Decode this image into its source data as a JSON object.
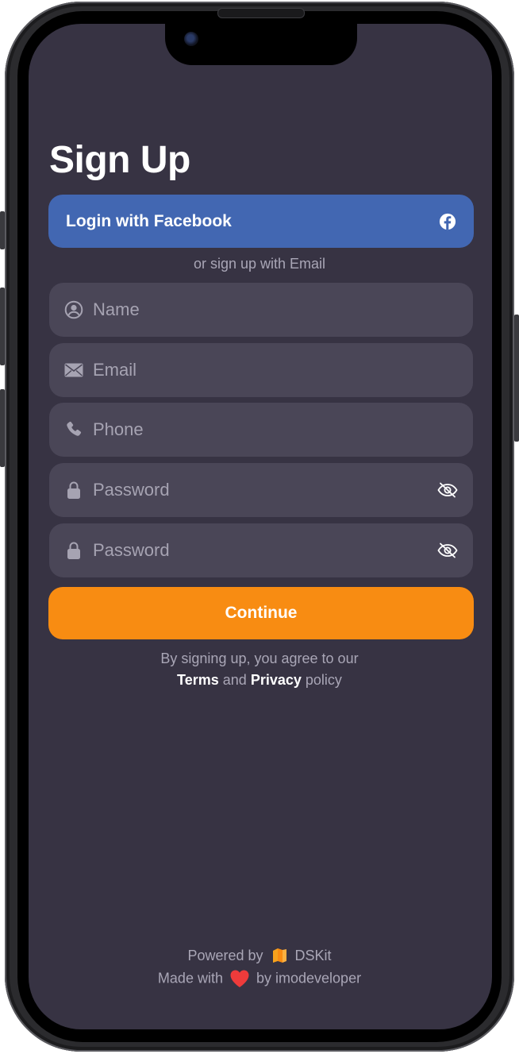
{
  "screen": {
    "title": "Sign Up"
  },
  "facebook_button": {
    "label": "Login with Facebook",
    "icon": "facebook-icon",
    "color": "#4267b2"
  },
  "divider_text": "or sign up with Email",
  "fields": {
    "name": {
      "placeholder": "Name",
      "value": "",
      "icon": "user-circle-icon"
    },
    "email": {
      "placeholder": "Email",
      "value": "",
      "icon": "envelope-icon"
    },
    "phone": {
      "placeholder": "Phone",
      "value": "",
      "icon": "phone-icon"
    },
    "password": {
      "placeholder": "Password",
      "value": "",
      "icon": "lock-icon",
      "toggle_icon": "eye-slash-icon"
    },
    "confirm_password": {
      "placeholder": "Password",
      "value": "",
      "icon": "lock-icon",
      "toggle_icon": "eye-slash-icon"
    }
  },
  "continue_button": {
    "label": "Continue",
    "color": "#f88c12"
  },
  "legal": {
    "line1": "By signing up, you agree to our",
    "terms": "Terms",
    "and": "and",
    "privacy": "Privacy",
    "policy": "policy"
  },
  "footer": {
    "powered_by": "Powered by",
    "brand": "DSKit",
    "made_with": "Made with",
    "by": "by imodeveloper"
  },
  "colors": {
    "background": "#373343",
    "field": "#4a4657",
    "text_muted": "#a9a6b6"
  }
}
